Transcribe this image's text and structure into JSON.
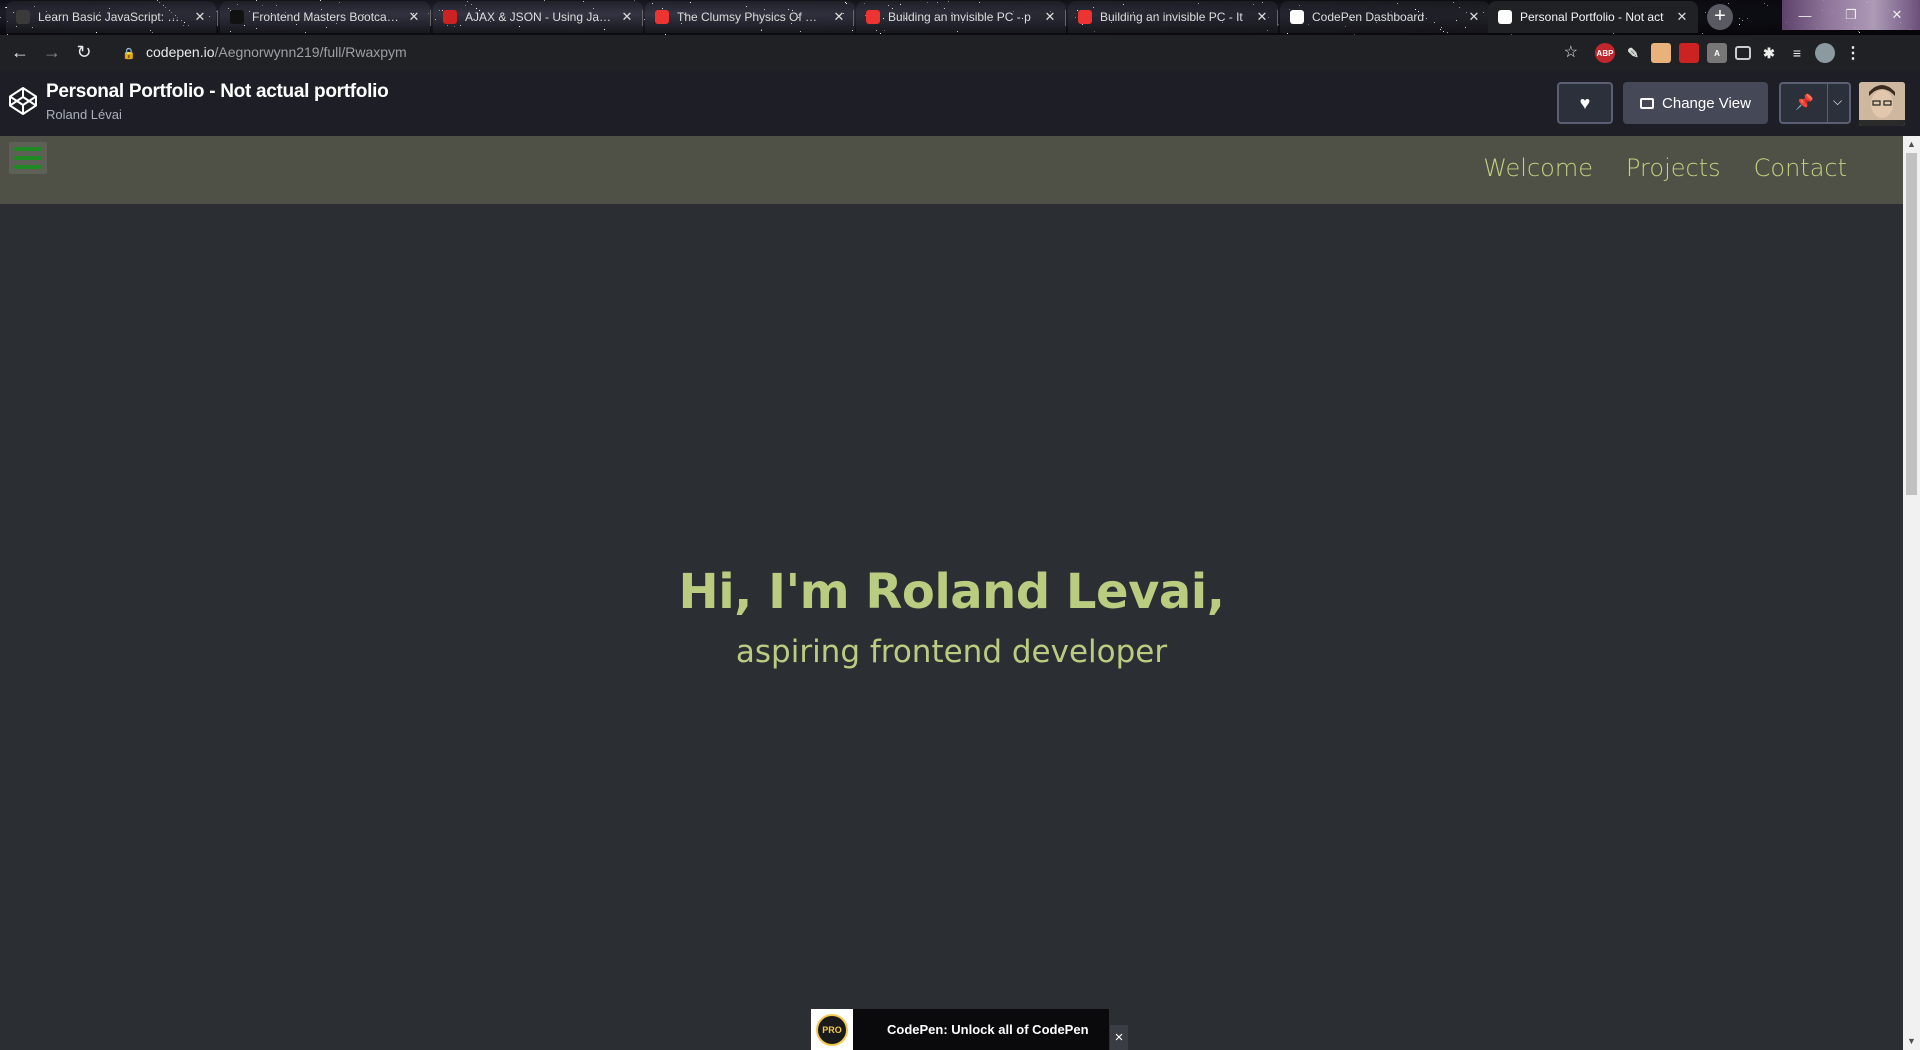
{
  "browser": {
    "tabs": [
      {
        "title": "Learn Basic JavaScript: Sele",
        "favicon": "freecodecamp-icon",
        "color": "#3a3a3a"
      },
      {
        "title": "Frontend Masters Bootcamp",
        "favicon": "frontend-masters-icon",
        "color": "#111111"
      },
      {
        "title": "AJAX & JSON - Using JavaS",
        "favicon": "ajax-icon",
        "color": "#c22"
      },
      {
        "title": "The Clumsy Physics Of Eati",
        "favicon": "youtube-icon",
        "color": "#e33"
      },
      {
        "title": "Building an invisible PC - p",
        "favicon": "youtube-icon",
        "color": "#e33"
      },
      {
        "title": "Building an invisible PC - It",
        "favicon": "youtube-icon",
        "color": "#e33"
      },
      {
        "title": "CodePen Dashboard",
        "favicon": "codepen-icon",
        "color": "#fff"
      },
      {
        "title": "Personal Portfolio - Not act",
        "favicon": "codepen-icon",
        "color": "#fff",
        "active": true
      }
    ],
    "new_tab": "+",
    "url_host": "codepen.io",
    "url_path": "/Aegnorwynn219/full/Rwaxpym"
  },
  "codepen": {
    "pen_title": "Personal Portfolio - Not actual portfolio",
    "author": "Roland Lévai",
    "change_view_label": "Change View"
  },
  "page": {
    "nav_links": [
      "Welcome",
      "Projects",
      "Contact"
    ],
    "hero_title": "Hi, I'm Roland Levai,",
    "hero_subtitle": "aspiring frontend developer",
    "accent_color": "#b9cc80",
    "navbar_color": "#4f5146"
  },
  "promo": {
    "badge": "PRO",
    "text": "CodePen: Unlock all of CodePen",
    "close": "×"
  }
}
